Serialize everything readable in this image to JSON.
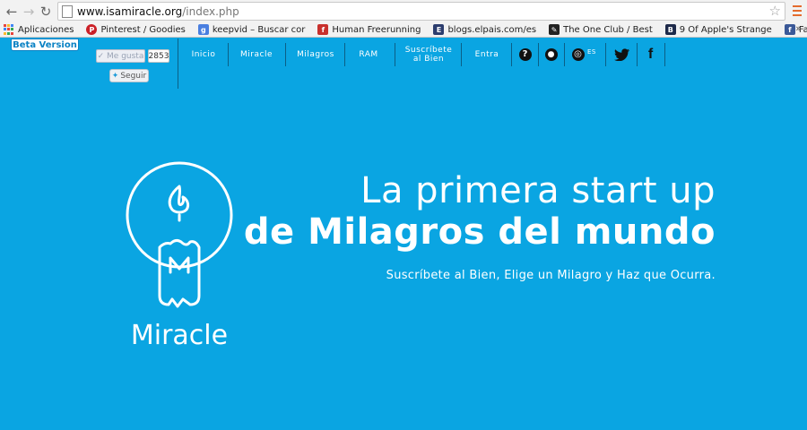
{
  "browser": {
    "url_domain": "www.isamiracle.org",
    "url_path": "/index.php",
    "bookmarks": [
      {
        "label": "Aplicaciones",
        "icon": "apps-grid-icon"
      },
      {
        "label": "Pinterest / Goodies",
        "icon": "pinterest-icon",
        "color": "#cb2027"
      },
      {
        "label": "keepvid – Buscar cor",
        "icon": "google-icon",
        "color": "#4a7fe0"
      },
      {
        "label": "Human Freerunning",
        "icon": "flickr-f-icon",
        "color": "#c8302c"
      },
      {
        "label": "blogs.elpais.com/es",
        "icon": "elpais-e-icon",
        "color": "#2c3d6e"
      },
      {
        "label": "The One Club / Best",
        "icon": "pencil-icon",
        "color": "#222222"
      },
      {
        "label": "9 Of Apple's Strange",
        "icon": "bi-icon",
        "color": "#1e2a4a"
      },
      {
        "label": "Facebook",
        "icon": "facebook-icon",
        "color": "#3b5998"
      }
    ],
    "bookmarks_more": "»"
  },
  "site": {
    "beta_label": "Beta Version",
    "like_label": "Me gusta",
    "like_count": "2853",
    "follow_label": "Seguir",
    "nav": [
      {
        "label": "Inicio"
      },
      {
        "label": "Miracle"
      },
      {
        "label": "Milagros"
      },
      {
        "label": "RAM"
      },
      {
        "label": "Suscríbete\nal Bien"
      },
      {
        "label": "Entra"
      }
    ],
    "language_label": "ES",
    "colors": {
      "background": "#0aa5e2",
      "accent": "#0a82c4"
    }
  },
  "hero": {
    "logo_text": "Miracle",
    "headline_line1": "La primera start up",
    "headline_line2": "de Milagros del mundo",
    "subline": "Suscríbete al Bien, Elige un Milagro y Haz que Ocurra."
  }
}
